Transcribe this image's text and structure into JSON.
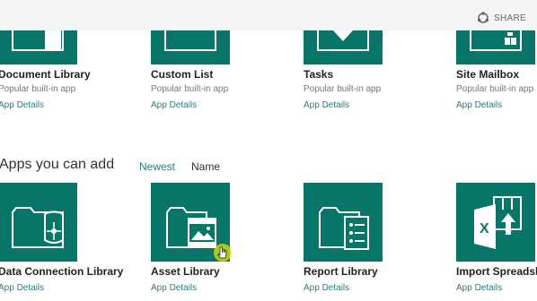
{
  "header": {
    "share_label": "SHARE"
  },
  "top_apps": [
    {
      "title": "Document Library",
      "subtitle": "Popular built-in app",
      "link": "App Details"
    },
    {
      "title": "Custom List",
      "subtitle": "Popular built-in app",
      "link": "App Details"
    },
    {
      "title": "Tasks",
      "subtitle": "Popular built-in app",
      "link": "App Details"
    },
    {
      "title": "Site Mailbox",
      "subtitle": "Popular built-in app",
      "link": "App Details"
    }
  ],
  "apps_section": {
    "title": "Apps you can add",
    "sort_newest": "Newest",
    "sort_name": "Name"
  },
  "bottom_apps": [
    {
      "title": "Data Connection Library",
      "link": "App Details",
      "icon": "data-connection-library-icon"
    },
    {
      "title": "Asset Library",
      "link": "App Details",
      "icon": "asset-library-icon"
    },
    {
      "title": "Report Library",
      "link": "App Details",
      "icon": "report-library-icon"
    },
    {
      "title": "Import Spreadsh",
      "link": "App Details",
      "icon": "import-spreadsheet-icon"
    }
  ],
  "colors": {
    "tile": "#077568",
    "link": "#2c7d80",
    "cursor_highlight": "#e6e600"
  }
}
